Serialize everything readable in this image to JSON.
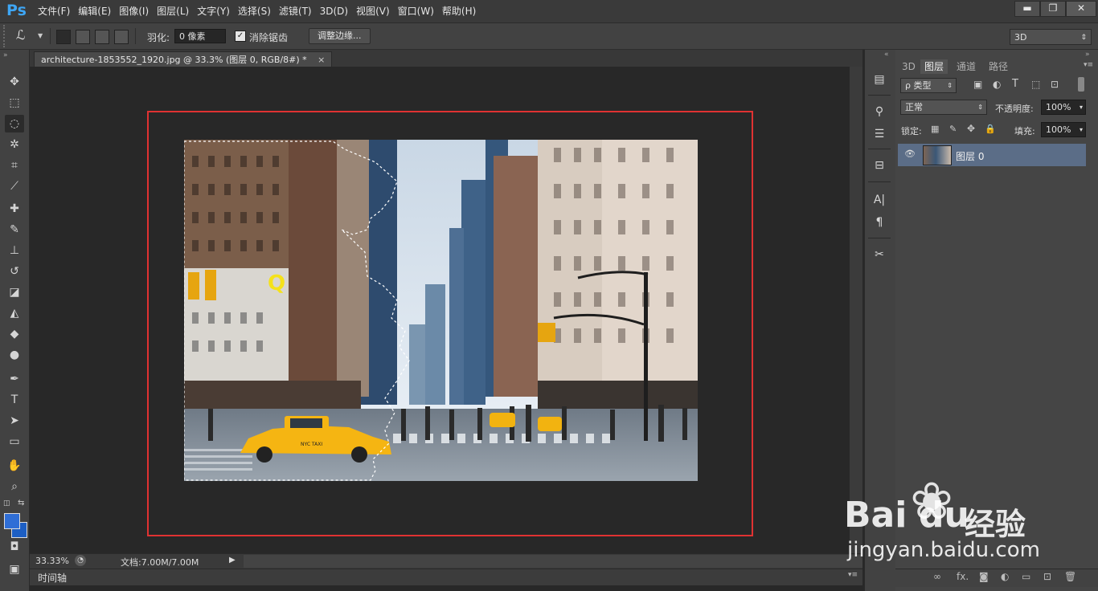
{
  "app": {
    "logo": "Ps",
    "menus": [
      "文件(F)",
      "编辑(E)",
      "图像(I)",
      "图层(L)",
      "文字(Y)",
      "选择(S)",
      "滤镜(T)",
      "3D(D)",
      "视图(V)",
      "窗口(W)",
      "帮助(H)"
    ],
    "window_buttons": [
      "▬",
      "❐",
      "✕"
    ]
  },
  "options": {
    "tool_glyph": "ℒ",
    "feather_label": "羽化:",
    "feather_value": "0 像素",
    "antialias_label": "消除锯齿",
    "antialias_checked": "✓",
    "refine_edge": "调整边缘...",
    "workspace": "3D"
  },
  "tabs": {
    "document": "architecture-1853552_1920.jpg @ 33.3% (图层 0, RGB/8#) *",
    "close": "×"
  },
  "status": {
    "zoom": "33.33%",
    "doc_size": "文档:7.00M/7.00M",
    "timeline": "时间轴"
  },
  "photo": {
    "annotation_letter": "Q",
    "taxi_text": "NYC TAXI"
  },
  "layers_panel": {
    "tabs": [
      "3D",
      "图层",
      "通道",
      "路径"
    ],
    "filter_label": "ρ 类型",
    "blend_mode": "正常",
    "opacity_label": "不透明度:",
    "opacity_value": "100%",
    "lock_label": "锁定:",
    "fill_label": "填充:",
    "fill_value": "100%",
    "layer_name": "图层 0",
    "bottom_icons": [
      "∞",
      "fx.",
      "◙",
      "◐",
      "▭",
      "⊡",
      "🗑"
    ]
  },
  "watermark": {
    "brand": "Bai",
    "brand2": "du",
    "cn": "经验",
    "url": "jingyan.baidu.com"
  }
}
